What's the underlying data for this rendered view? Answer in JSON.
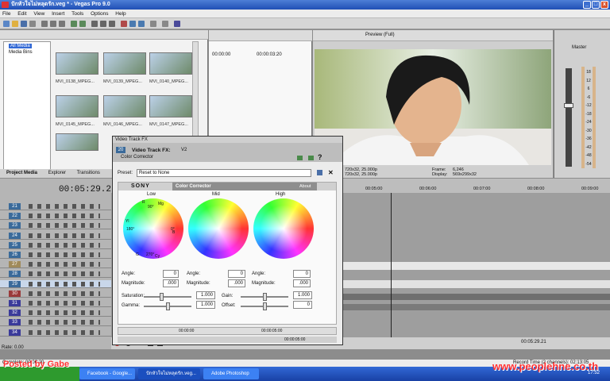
{
  "window": {
    "title": "ปักหัวใจไม่หลุดรัก.veg * - Vegas Pro 9.0",
    "min": "_",
    "max": "□",
    "close": "x"
  },
  "menu": [
    "File",
    "Edit",
    "View",
    "Insert",
    "Tools",
    "Options",
    "Help"
  ],
  "media": {
    "tree": [
      "All Media",
      "Media Bins"
    ],
    "thumbs": [
      "MVI_0138_MPEG...",
      "MVI_0139_MPEG...",
      "MVI_0140_MPEG...",
      "MVI_0145_MPEG...",
      "MVI_0146_MPEG...",
      "MVI_0147_MPEG..."
    ]
  },
  "tabs": [
    "Project Media",
    "Explorer",
    "Transitions"
  ],
  "trimmer": {
    "time1": "00:00:00",
    "time2": "00:00:03:20"
  },
  "preview": {
    "mode": "Preview (Full)",
    "info1": "720x32, 25.000p",
    "info2": "720x32, 25.000p",
    "frame_label": "Frame:",
    "frame_value": "6,246",
    "display_label": "Display:",
    "display_value": "569x299x32"
  },
  "master": {
    "label": "Master",
    "scale": [
      "18",
      "12",
      "6",
      "-6",
      "-12",
      "-18",
      "-24",
      "-30",
      "-36",
      "-42",
      "-48",
      "-54"
    ]
  },
  "timecode": "00:05:29.21",
  "tracks": [
    "21",
    "22",
    "23",
    "24",
    "25",
    "26",
    "27",
    "28",
    "29",
    "30",
    "31",
    "32",
    "33",
    "34"
  ],
  "ruler": [
    "00:05:00",
    "00:06:00",
    "00:07:00",
    "00:08:00",
    "00:09:00"
  ],
  "fx": {
    "window_title": "Video Track FX",
    "track_num": "20",
    "track_label": "Video Track FX:",
    "track_suffix": "V2",
    "chain_item": "Color Corrector",
    "preset_label": "Preset:",
    "preset_value": "Reset to None",
    "brand": "SONY",
    "plugin_name": "Color Corrector",
    "about": "About",
    "low": "Low",
    "mid": "Mid",
    "high": "High",
    "angle": "Angle:",
    "magnitude": "Magnitude:",
    "angle_val": "0",
    "mag_val": ".000",
    "saturation": "Saturation:",
    "sat_val": "1.000",
    "gain": "Gain:",
    "gain_val": "1.000",
    "gamma": "Gamma:",
    "gamma_val": "1.000",
    "offset": "Offset:",
    "offset_val": "0",
    "t0": "00:00:00",
    "t1": "00:00:05:00",
    "t2": "00:00:05:00",
    "w90": "90°",
    "w180": "180°",
    "w0": "0°",
    "w270": "270°",
    "R": "R",
    "Mg": "Mg",
    "B": "B",
    "Yl": "Yl",
    "Cy": "Cy",
    "G": "G"
  },
  "transport": {
    "rate": "Rate: 0.00",
    "time": "00:05:29.21",
    "record_time": "Record Time (2 channels): 02:13:05"
  },
  "status": {
    "left": "Complete: 00:00:20"
  },
  "taskbar": {
    "items": [
      "Facebook - Google...",
      "ปักหัวใจไม่หลุดรัก.veg...",
      "Adobe Photoshop"
    ],
    "watermark_left": "Posted by Gabe",
    "watermark_right": "www.peoplehne.co.th",
    "clock": "17:52"
  }
}
